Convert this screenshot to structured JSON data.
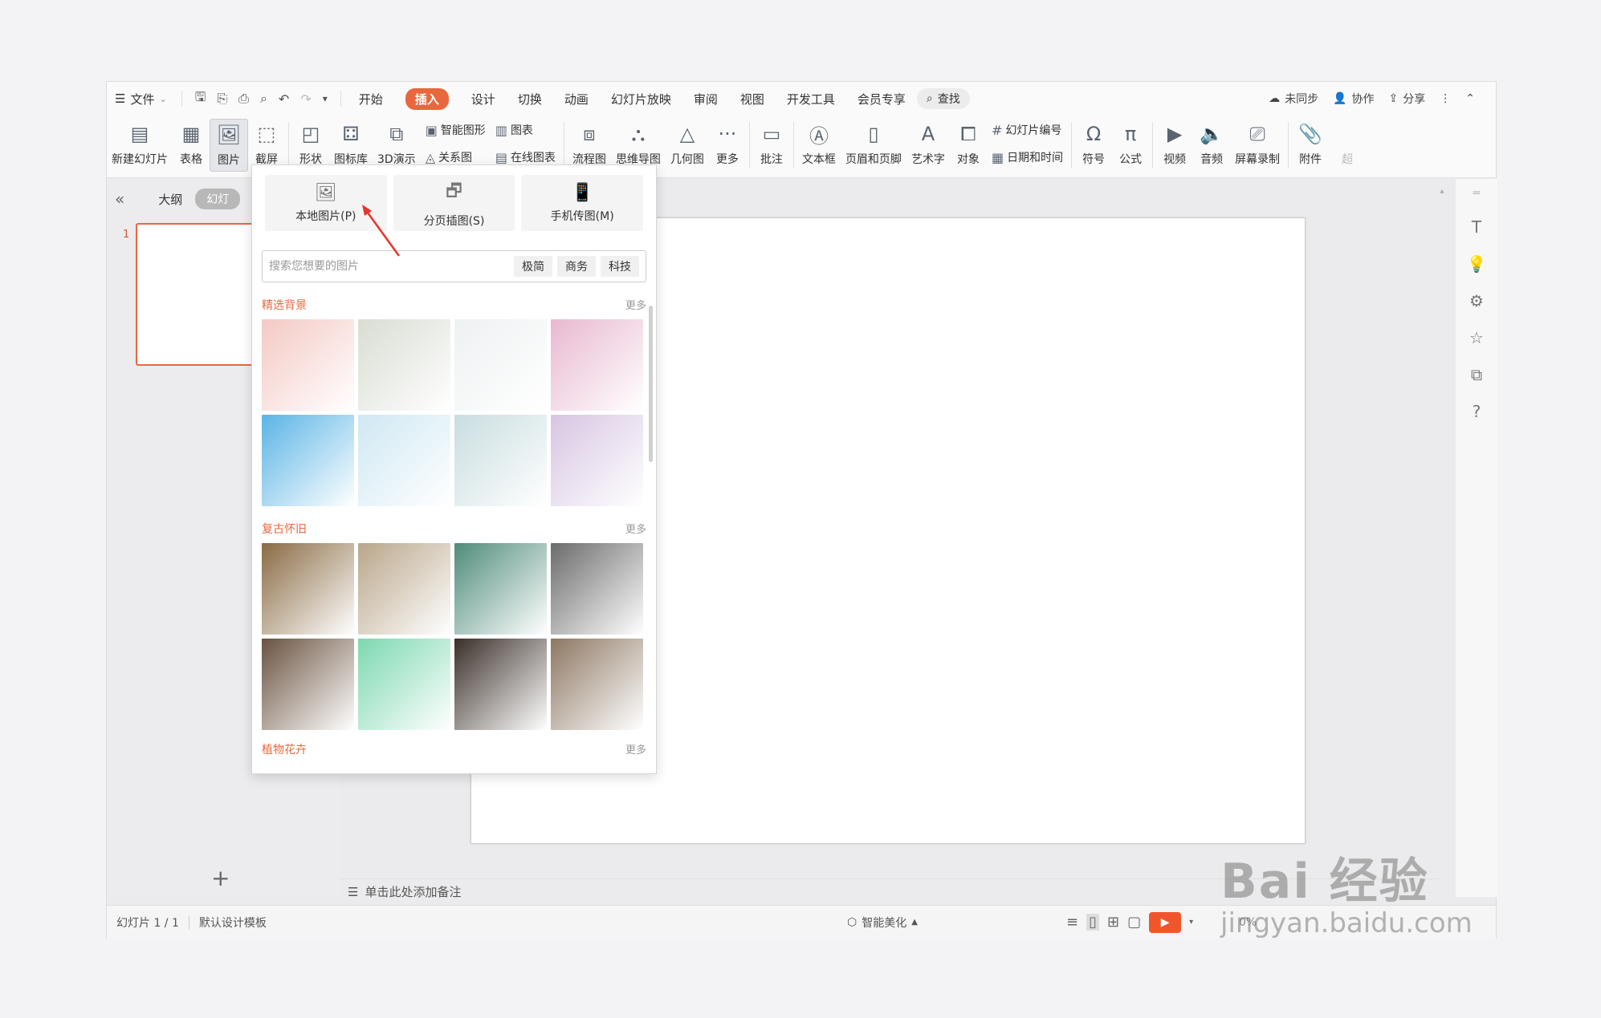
{
  "menubar": {
    "file_label": "文件",
    "tabs": [
      {
        "label": "开始",
        "active": false
      },
      {
        "label": "插入",
        "active": true
      },
      {
        "label": "设计",
        "active": false
      },
      {
        "label": "切换",
        "active": false
      },
      {
        "label": "动画",
        "active": false
      },
      {
        "label": "幻灯片放映",
        "active": false
      },
      {
        "label": "审阅",
        "active": false
      },
      {
        "label": "视图",
        "active": false
      },
      {
        "label": "开发工具",
        "active": false
      },
      {
        "label": "会员专享",
        "active": false
      }
    ],
    "search_label": "查找",
    "unsync_label": "未同步",
    "collab_label": "协作",
    "share_label": "分享"
  },
  "ribbon": {
    "new_slide": "新建幻灯片",
    "table": "表格",
    "picture": "图片",
    "screenshot": "截屏",
    "shape": "形状",
    "icon_lib": "图标库",
    "demo3d": "3D演示",
    "smart_art": "智能图形",
    "relation": "关系图",
    "chart": "图表",
    "online_chart": "在线图表",
    "flowchart": "流程图",
    "mindmap": "思维导图",
    "geometry": "几何图",
    "more": "更多",
    "comment": "批注",
    "textbox": "文本框",
    "header_footer": "页眉和页脚",
    "wordart": "艺术字",
    "object": "对象",
    "slide_number": "幻灯片编号",
    "datetime": "日期和时间",
    "symbol": "符号",
    "formula": "公式",
    "video": "视频",
    "audio": "音频",
    "screen_record": "屏幕录制",
    "attachment": "附件",
    "cut_off": "超"
  },
  "left_panel": {
    "outline_label": "大纲",
    "slides_label": "幻灯",
    "slide_number": "1"
  },
  "notes": {
    "placeholder": "单击此处添加备注"
  },
  "status": {
    "slide_info": "幻灯片 1 / 1",
    "template": "默认设计模板",
    "beautify": "智能美化",
    "zoom": "0%"
  },
  "picture_dropdown": {
    "local_picture": "本地图片(P)",
    "page_picture": "分页插图(S)",
    "phone_picture": "手机传图(M)",
    "search_placeholder": "搜索您想要的图片",
    "tags": [
      "极简",
      "商务",
      "科技"
    ],
    "sections": [
      {
        "title": "精选背景",
        "more": "更多",
        "colors": [
          "#f4c9c4",
          "#d9ddd3",
          "#eef1f2",
          "#e8b8d0",
          "#5ab4e6",
          "#cfe8f3",
          "#c9dde0",
          "#d7c5e2"
        ]
      },
      {
        "title": "复古怀旧",
        "more": "更多",
        "colors": [
          "#8a6b44",
          "#b9a68a",
          "#4f8c7a",
          "#6b6b6b",
          "#6a5240",
          "#7cd8b0",
          "#3a2f29",
          "#8d7762"
        ]
      },
      {
        "title": "植物花卉",
        "more": "更多",
        "colors": []
      }
    ]
  },
  "watermark": {
    "brand": "Bai 经验",
    "url": "jingyan.baidu.com"
  },
  "colors": {
    "accent": "#e9673e",
    "play": "#f0562b"
  }
}
